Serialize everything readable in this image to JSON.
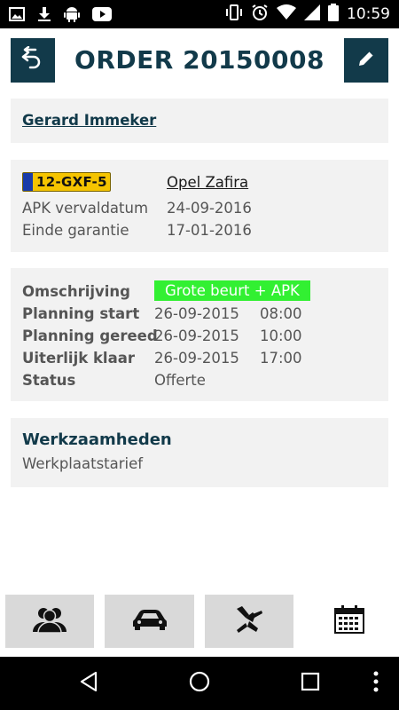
{
  "status_bar": {
    "time": "10:59",
    "left_icons": [
      "image-icon",
      "download-icon",
      "android-icon",
      "youtube-icon"
    ],
    "right_icons": [
      "vibrate-icon",
      "alarm-icon",
      "wifi-icon",
      "signal-icon",
      "battery-icon"
    ]
  },
  "header": {
    "title": "ORDER 20150008",
    "back_icon": "back-icon",
    "edit_icon": "edit-icon",
    "accent_color": "#123a4a"
  },
  "customer": {
    "name": "Gerard Immeker"
  },
  "vehicle": {
    "plate": "12-GXF-5",
    "model": "Opel Zafira",
    "apk_label": "APK vervaldatum",
    "apk_value": "24-09-2016",
    "warranty_label": "Einde garantie",
    "warranty_value": "17-01-2016"
  },
  "order": {
    "description_label": "Omschrijving",
    "description_value": "Grote beurt + APK",
    "planning_start_label": "Planning start",
    "planning_start_date": "26-09-2015",
    "planning_start_time": "08:00",
    "planning_ready_label": "Planning gereed",
    "planning_ready_date": "26-09-2015",
    "planning_ready_time": "10:00",
    "latest_ready_label": "Uiterlijk klaar",
    "latest_ready_date": "26-09-2015",
    "latest_ready_time": "17:00",
    "status_label": "Status",
    "status_value": "Offerte",
    "highlight_color": "#32f032"
  },
  "activities": {
    "title": "Werkzaamheden",
    "items": [
      "Werkplaatstarief"
    ]
  },
  "tabs": [
    {
      "icon": "customers-icon"
    },
    {
      "icon": "car-icon"
    },
    {
      "icon": "parts-icon"
    },
    {
      "icon": "calendar-icon"
    }
  ],
  "nav_bar": {
    "icons": [
      "nav-back-icon",
      "nav-home-icon",
      "nav-recents-icon",
      "nav-menu-icon"
    ]
  }
}
